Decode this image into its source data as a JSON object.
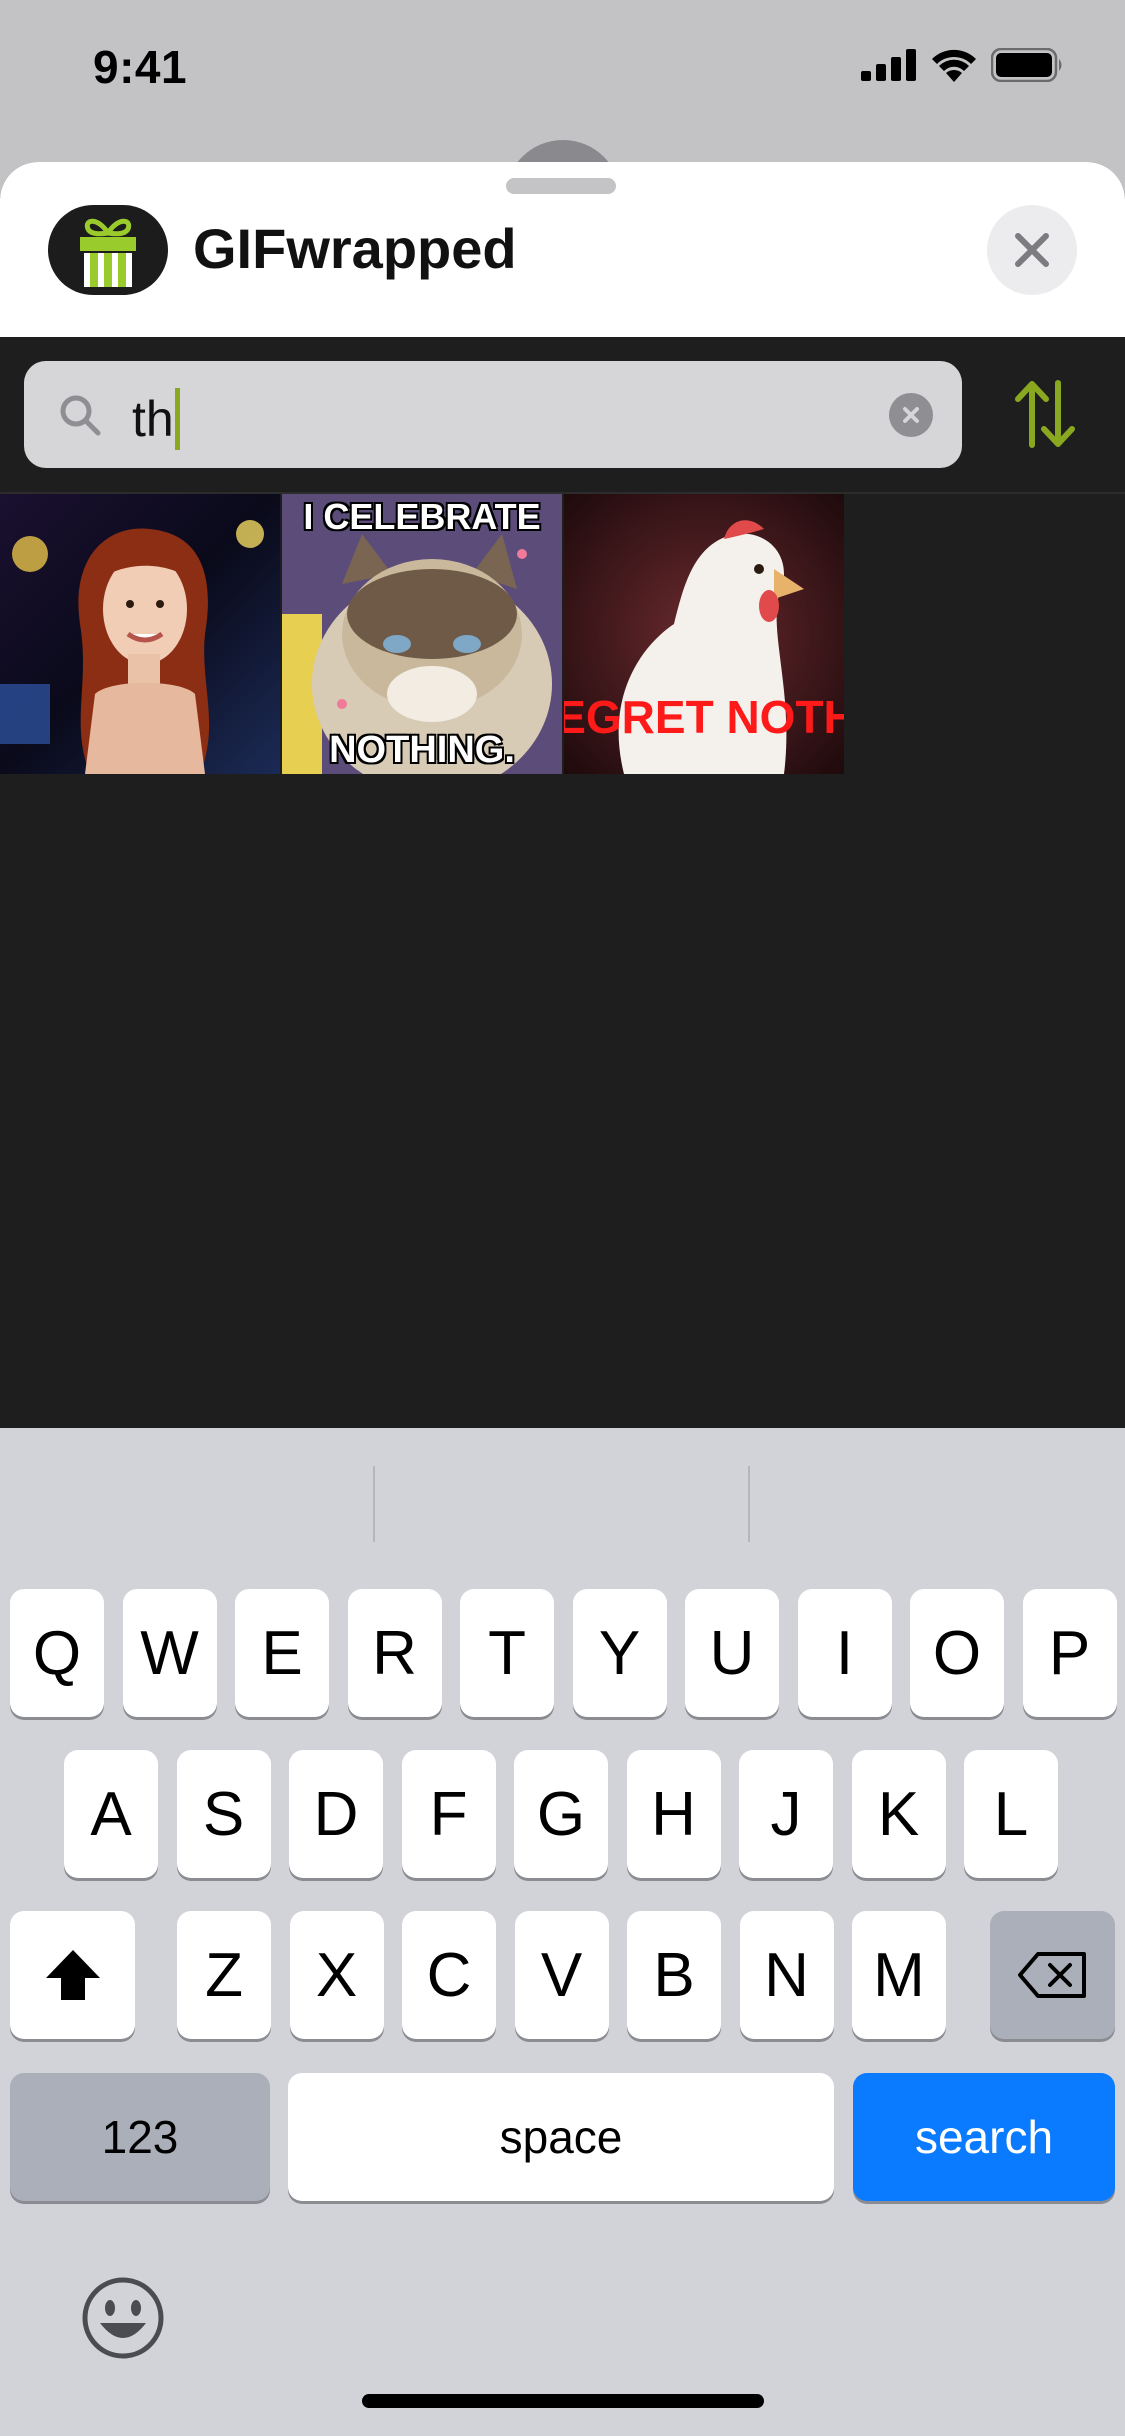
{
  "status_bar": {
    "time": "9:41"
  },
  "header": {
    "app_name": "GIFwrapped"
  },
  "search": {
    "query": "th"
  },
  "results": [
    {
      "top_caption": "",
      "bottom_caption": ""
    },
    {
      "top_caption": "I CELEBRATE",
      "bottom_caption": "NOTHING."
    },
    {
      "top_caption": "",
      "bottom_caption": "EGRET NOTH"
    }
  ],
  "keyboard": {
    "row1": [
      "Q",
      "W",
      "E",
      "R",
      "T",
      "Y",
      "U",
      "I",
      "O",
      "P"
    ],
    "row2": [
      "A",
      "S",
      "D",
      "F",
      "G",
      "H",
      "J",
      "K",
      "L"
    ],
    "row3": [
      "Z",
      "X",
      "C",
      "V",
      "B",
      "N",
      "M"
    ],
    "numbers_label": "123",
    "space_label": "space",
    "search_label": "search"
  },
  "colors": {
    "accent": "#8aa81f",
    "search_key": "#0a7aff",
    "sheet_bg": "#1e1e1e"
  }
}
